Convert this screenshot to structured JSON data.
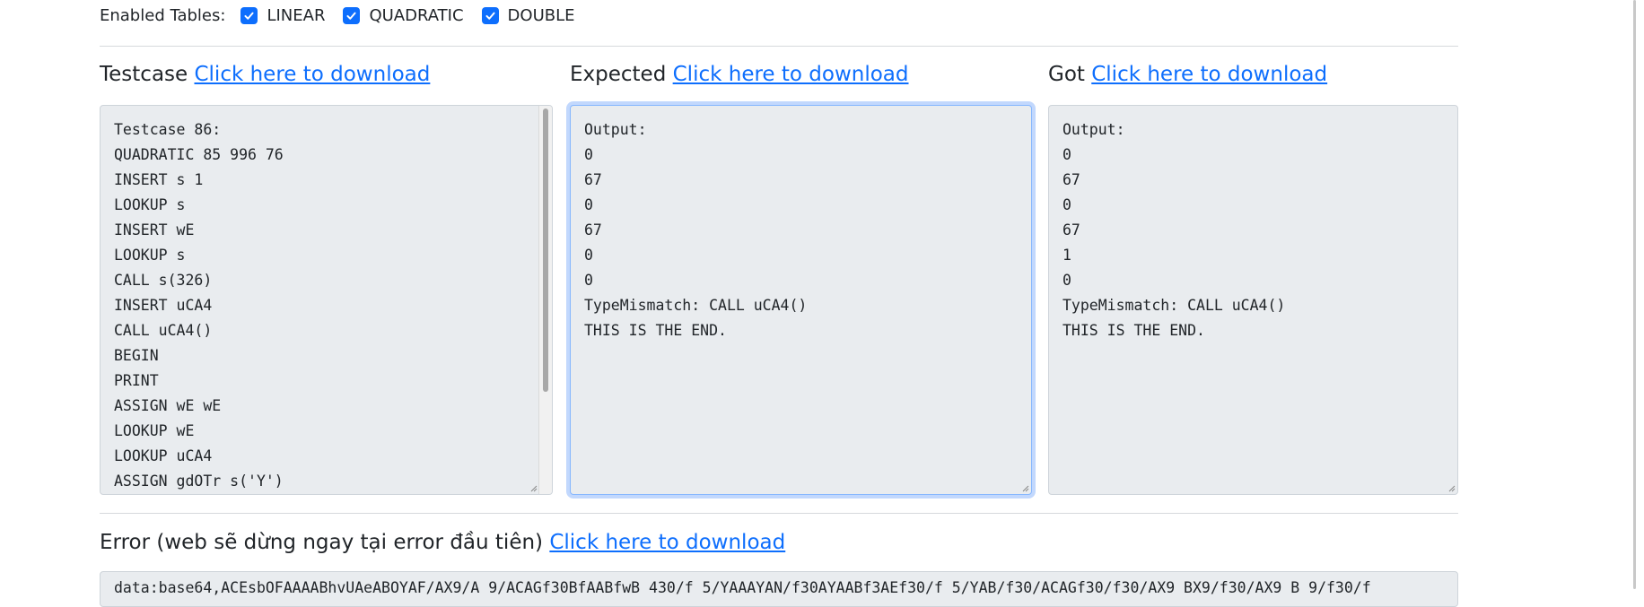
{
  "tables": {
    "label": "Enabled Tables:",
    "options": [
      {
        "label": "LINEAR",
        "checked": true
      },
      {
        "label": "QUADRATIC",
        "checked": true
      },
      {
        "label": "DOUBLE",
        "checked": true
      }
    ]
  },
  "testcase": {
    "title": "Testcase",
    "link": "Click here to download",
    "lines": [
      "Testcase 86:",
      "QUADRATIC 85 996 76",
      "INSERT s 1",
      "LOOKUP s",
      "INSERT wE",
      "LOOKUP s",
      "CALL s(326)",
      "INSERT uCA4",
      "CALL uCA4()",
      "BEGIN",
      "PRINT",
      "ASSIGN wE wE",
      "LOOKUP wE",
      "LOOKUP uCA4",
      "ASSIGN gdOTr s('Y')"
    ]
  },
  "expected": {
    "title": "Expected",
    "link": "Click here to download",
    "lines": [
      "Output:",
      "0",
      "67",
      "0",
      "67",
      "0",
      "0",
      "TypeMismatch: CALL uCA4()",
      "THIS IS THE END."
    ]
  },
  "got": {
    "title": "Got",
    "link": "Click here to download",
    "lines": [
      "Output:",
      "0",
      "67",
      "0",
      "67",
      "1",
      "0",
      "TypeMismatch: CALL uCA4()",
      "THIS IS THE END."
    ]
  },
  "error": {
    "title": "Error (web sẽ dừng ngay tại error đầu tiên)",
    "link": "Click here to download",
    "visible_text": "data:base64,ACEsbOFAAAABhvUAeABOYAF/AX9/A 9/ACAGf30BfAABfwB 430/f 5/YAAAYAN/f30AYAABf3AEf30/f 5/YAB/f30/ACAGf30/f30/AX9 BX9/f30/AX9 B 9/f30/f"
  },
  "colors": {
    "link": "#0d6efd",
    "checkbox": "#0d6efd",
    "textarea_bg": "#e9ecef",
    "focus_ring": "#86b7fe"
  }
}
